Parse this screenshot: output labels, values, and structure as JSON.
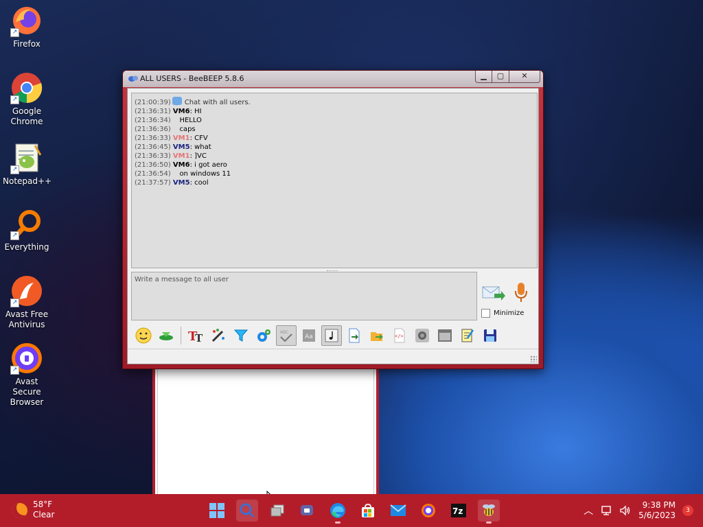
{
  "desktop": {
    "icons": [
      {
        "label": "Firefox"
      },
      {
        "label": "Google Chrome"
      },
      {
        "label": "Notepad++"
      },
      {
        "label": "Everything"
      },
      {
        "label": "Avast Free Antivirus"
      },
      {
        "label": "Avast Secure Browser"
      }
    ]
  },
  "window": {
    "title": "ALL USERS - BeeBEEP 5.8.6",
    "chat": [
      {
        "time": "(21:00:39)",
        "user": "",
        "text": "Chat with all users.",
        "kind": "system"
      },
      {
        "time": "(21:36:31)",
        "user": "VM6",
        "text": " HI"
      },
      {
        "time": "(21:36:34)",
        "user": "",
        "text": "HELLO"
      },
      {
        "time": "(21:36:36)",
        "user": "",
        "text": "caps"
      },
      {
        "time": "(21:36:33)",
        "user": "VM1",
        "text": " CFV"
      },
      {
        "time": "(21:36:45)",
        "user": "VM5",
        "text": " what"
      },
      {
        "time": "(21:36:33)",
        "user": "VM1",
        "text": " ]VC"
      },
      {
        "time": "(21:36:50)",
        "user": "VM6",
        "text": " i got aero"
      },
      {
        "time": "(21:36:54)",
        "user": "",
        "text": "on windows 11"
      },
      {
        "time": "(21:37:57)",
        "user": "VM5",
        "text": " cool"
      }
    ],
    "input_placeholder": "Write a message to all user",
    "minimize_label": "Minimize"
  },
  "taskbar": {
    "weather_temp": "58°F",
    "weather_desc": "Clear",
    "time": "9:38 PM",
    "date": "5/6/2023",
    "notifications": "3"
  }
}
